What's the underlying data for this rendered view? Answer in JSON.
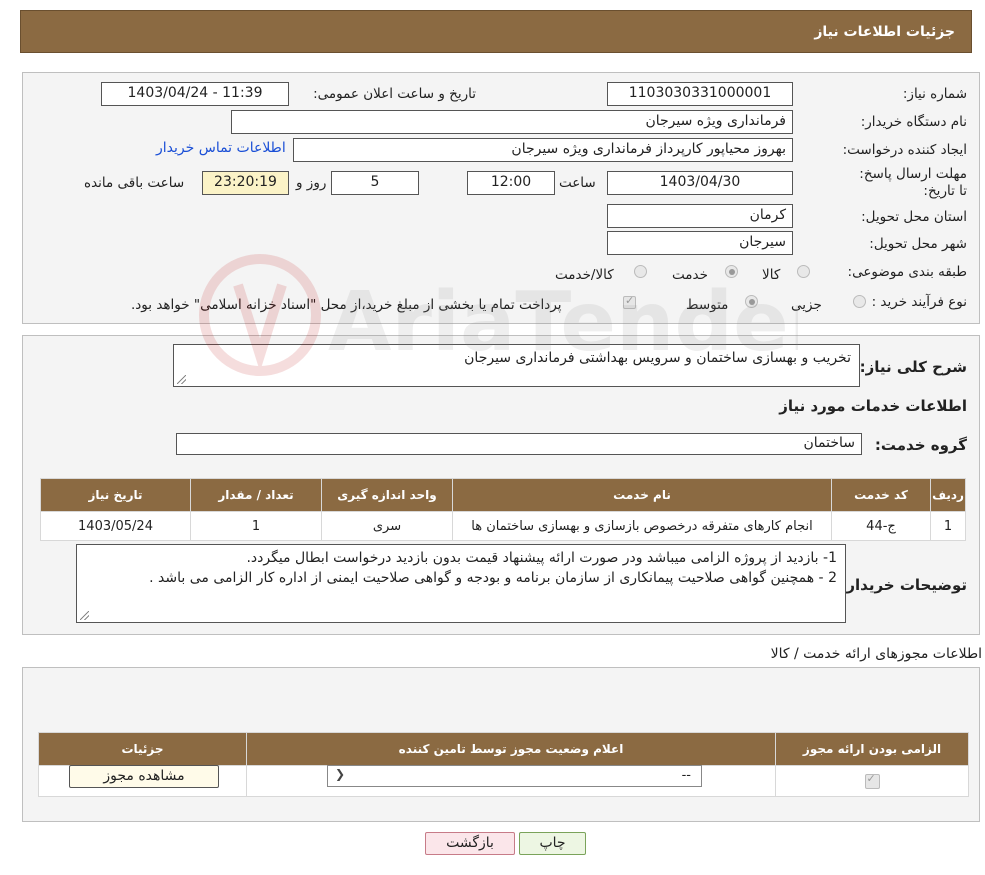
{
  "header": {
    "title": "جزئیات اطلاعات نیاز"
  },
  "fields": {
    "need_number_label": "شماره نیاز:",
    "need_number": "1103030331000001",
    "announce_label": "تاریخ و ساعت اعلان عمومی:",
    "announce_value": "1403/04/24 - 11:39",
    "buyer_org_label": "نام دستگاه خریدار:",
    "buyer_org": "فرمانداری ویژه سیرجان",
    "creator_label": "ایجاد کننده درخواست:",
    "creator": "بهروز محیاپور کارپرداز فرمانداری ویژه سیرجان",
    "contact_link": "اطلاعات تماس خریدار",
    "deadline_label": "مهلت ارسال پاسخ: تا تاریخ:",
    "deadline_date": "1403/04/30",
    "time_label": "ساعت",
    "deadline_time": "12:00",
    "days_value": "5",
    "days_label": "روز و",
    "remaining_time": "23:20:19",
    "remaining_label": "ساعت باقی مانده",
    "province_label": "استان محل تحویل:",
    "province": "کرمان",
    "city_label": "شهر محل تحویل:",
    "city": "سیرجان",
    "category_label": "طبقه بندی موضوعی:",
    "category_options": [
      "کالا",
      "خدمت",
      "کالا/خدمت"
    ],
    "category_selected": "خدمت",
    "process_label": "نوع فرآیند خرید :",
    "process_options": [
      "جزیی",
      "متوسط"
    ],
    "process_selected": "متوسط",
    "payment_note": "پرداخت تمام یا بخشی از مبلغ خرید،از محل \"اسناد خزانه اسلامی\" خواهد بود."
  },
  "description": {
    "label": "شرح کلی نیاز:",
    "value": "تخریب و بهسازی ساختمان و سرویس بهداشتی فرمانداری سیرجان"
  },
  "services": {
    "section_title": "اطلاعات خدمات مورد نیاز",
    "group_label": "گروه خدمت:",
    "group_value": "ساختمان",
    "columns": [
      "ردیف",
      "کد خدمت",
      "نام خدمت",
      "واحد اندازه گیری",
      "تعداد / مقدار",
      "تاریخ نیاز"
    ],
    "rows": [
      [
        "1",
        "ج-44",
        "انجام کارهای متفرقه درخصوص بازسازی و بهسازی ساختمان ها",
        "سری",
        "1",
        "1403/05/24"
      ]
    ]
  },
  "buyer_notes": {
    "label": "توضیحات خریدار:",
    "line1": "1- بازدید از پروژه الزامی میباشد ودر صورت ارائه پیشنهاد قیمت بدون بازدید درخواست ابطال میگردد.",
    "line2": "2 - همچنین گواهی صلاحیت پیمانکاری از سازمان برنامه و بودجه  و گواهی صلاحیت ایمنی از اداره کار الزامی می باشد ."
  },
  "licenses": {
    "section_title": "اطلاعات مجوزهای ارائه خدمت / کالا",
    "columns": [
      "الزامی بودن ارائه مجوز",
      "اعلام وضعیت مجوز توسط تامین کننده",
      "جزئیات"
    ],
    "select_value": "--",
    "view_button": "مشاهده مجوز"
  },
  "actions": {
    "print": "چاپ",
    "back": "بازگشت"
  },
  "watermark": "AriaTender.neT",
  "colors": {
    "header": "#8B6A42",
    "link": "#1a4fd6"
  }
}
